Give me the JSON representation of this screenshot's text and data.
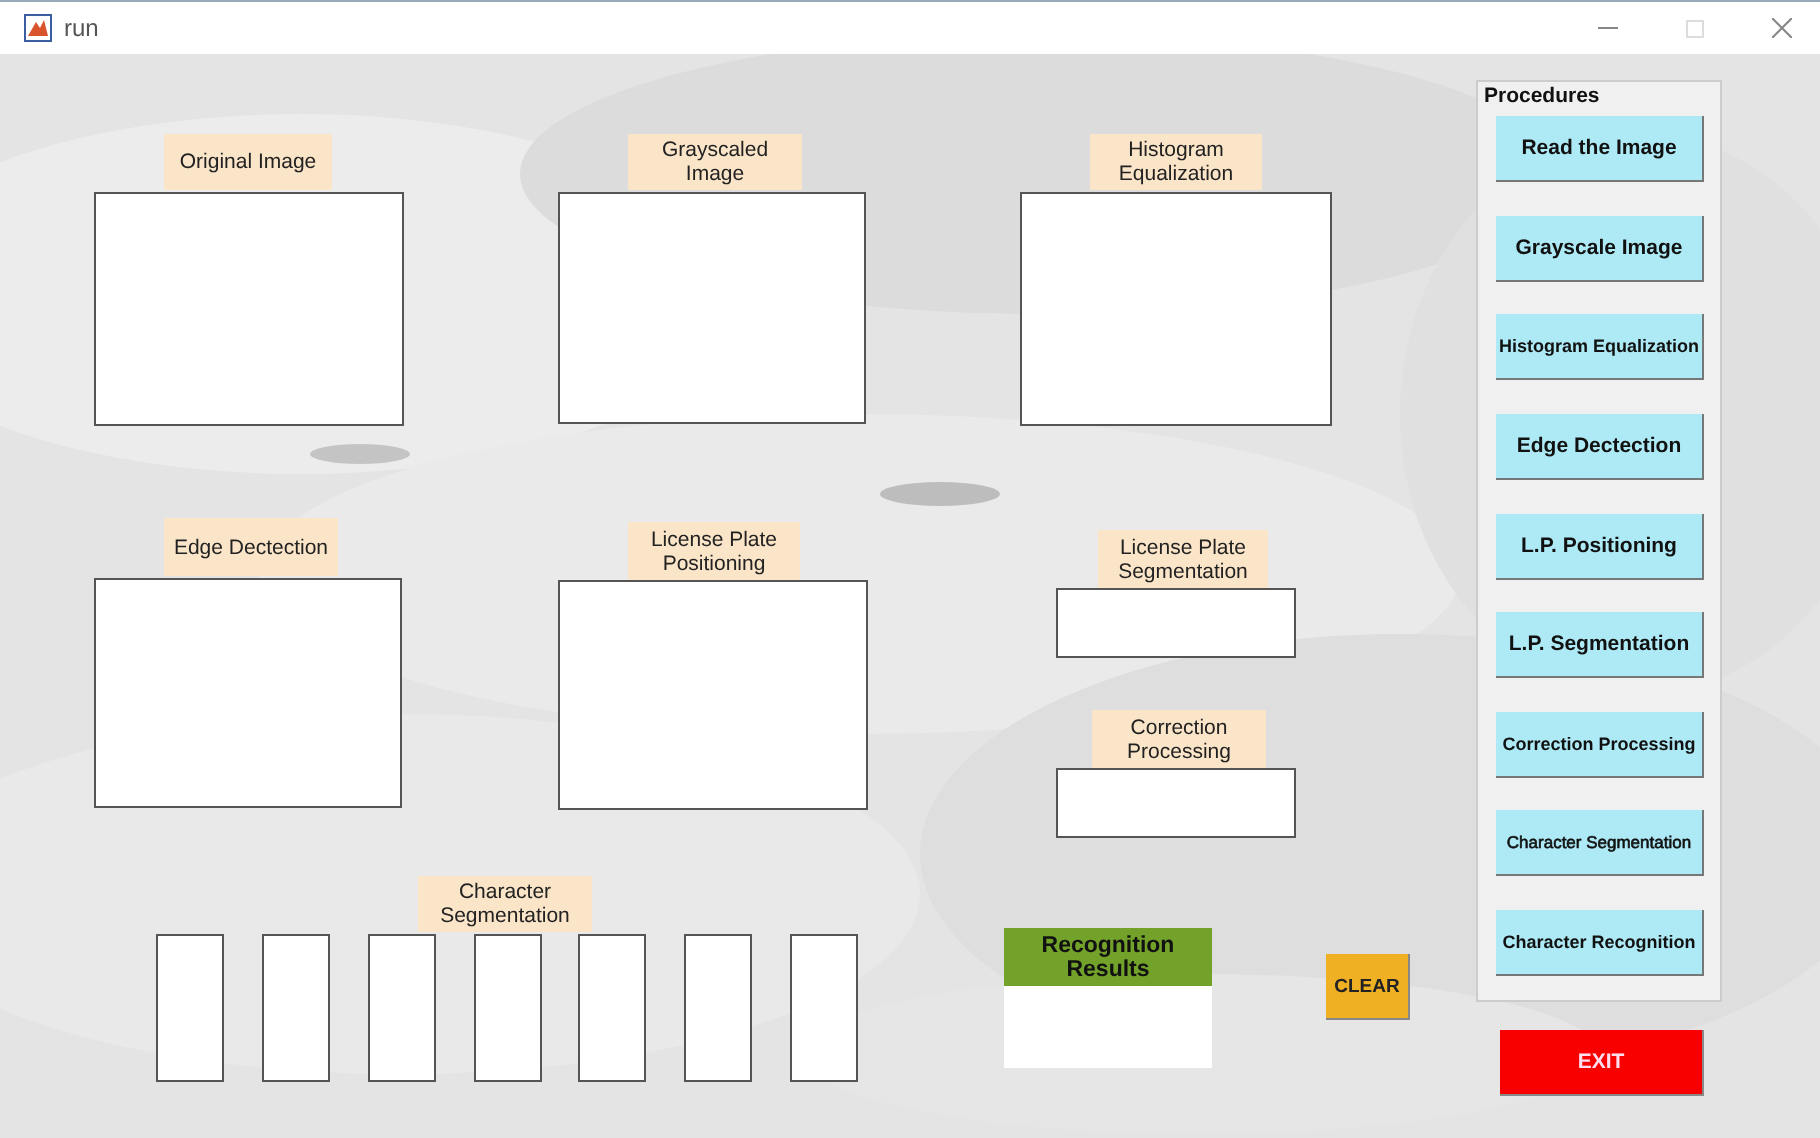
{
  "window": {
    "title": "run"
  },
  "image_panels": [
    {
      "label": "Original Image"
    },
    {
      "label": "Grayscaled Image"
    },
    {
      "label": "Histogram Equalization"
    },
    {
      "label": "Edge Dectection"
    },
    {
      "label": "License Plate Positioning"
    },
    {
      "label": "License Plate Segmentation"
    },
    {
      "label": "Correction Processing"
    }
  ],
  "character_segmentation": {
    "label": "Character Segmentation"
  },
  "recognition_results": {
    "label": "Recognition Results"
  },
  "clear_button": "CLEAR",
  "procedures": {
    "title": "Procedures",
    "buttons": [
      "Read the Image",
      "Grayscale Image",
      "Histogram Equalization",
      "Edge Dectection",
      "L.P. Positioning",
      "L.P. Segmentation",
      "Correction Processing",
      "Character Segmentation",
      "Character Recognition"
    ]
  },
  "exit_button": "EXIT"
}
